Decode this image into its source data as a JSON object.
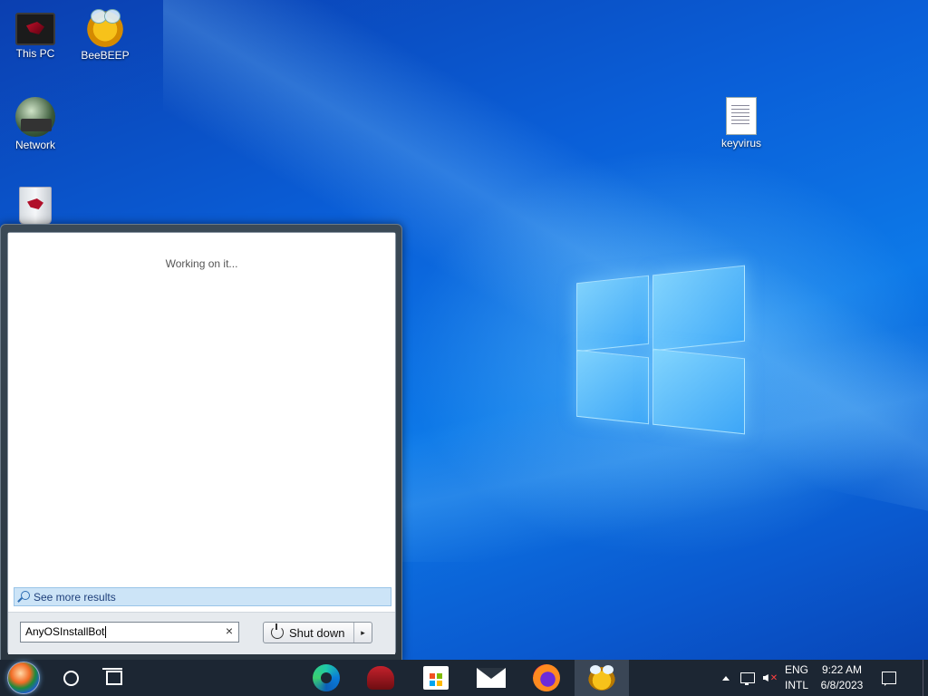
{
  "desktop": {
    "icons": [
      {
        "label": "This PC",
        "icon": "this-pc-icon"
      },
      {
        "label": "BeeBEEP",
        "icon": "beebeep-icon"
      },
      {
        "label": "Network",
        "icon": "network-icon"
      },
      {
        "label": "",
        "icon": "recycle-bin-icon"
      },
      {
        "label": "keyvirus",
        "icon": "text-file-icon"
      }
    ]
  },
  "start_menu": {
    "status_text": "Working on it...",
    "see_more_label": "See more results",
    "search_value": "AnyOSInstallBot",
    "clear_label": "×",
    "shutdown_label": "Shut down",
    "shutdown_arrow": "▸"
  },
  "taskbar": {
    "pinned": [
      "start-orb",
      "cortana-search",
      "task-view",
      "microsoft-edge",
      "app-helmet",
      "microsoft-store",
      "mail",
      "firefox",
      "beebeep"
    ],
    "tray": {
      "language": "ENG",
      "layout": "INTL",
      "time": "9:22 AM",
      "date": "6/8/2023"
    }
  },
  "colors": {
    "taskbar": "#1c2633",
    "wallpaper": "#0a63d6",
    "see_more_bg": "#cce4f7"
  }
}
